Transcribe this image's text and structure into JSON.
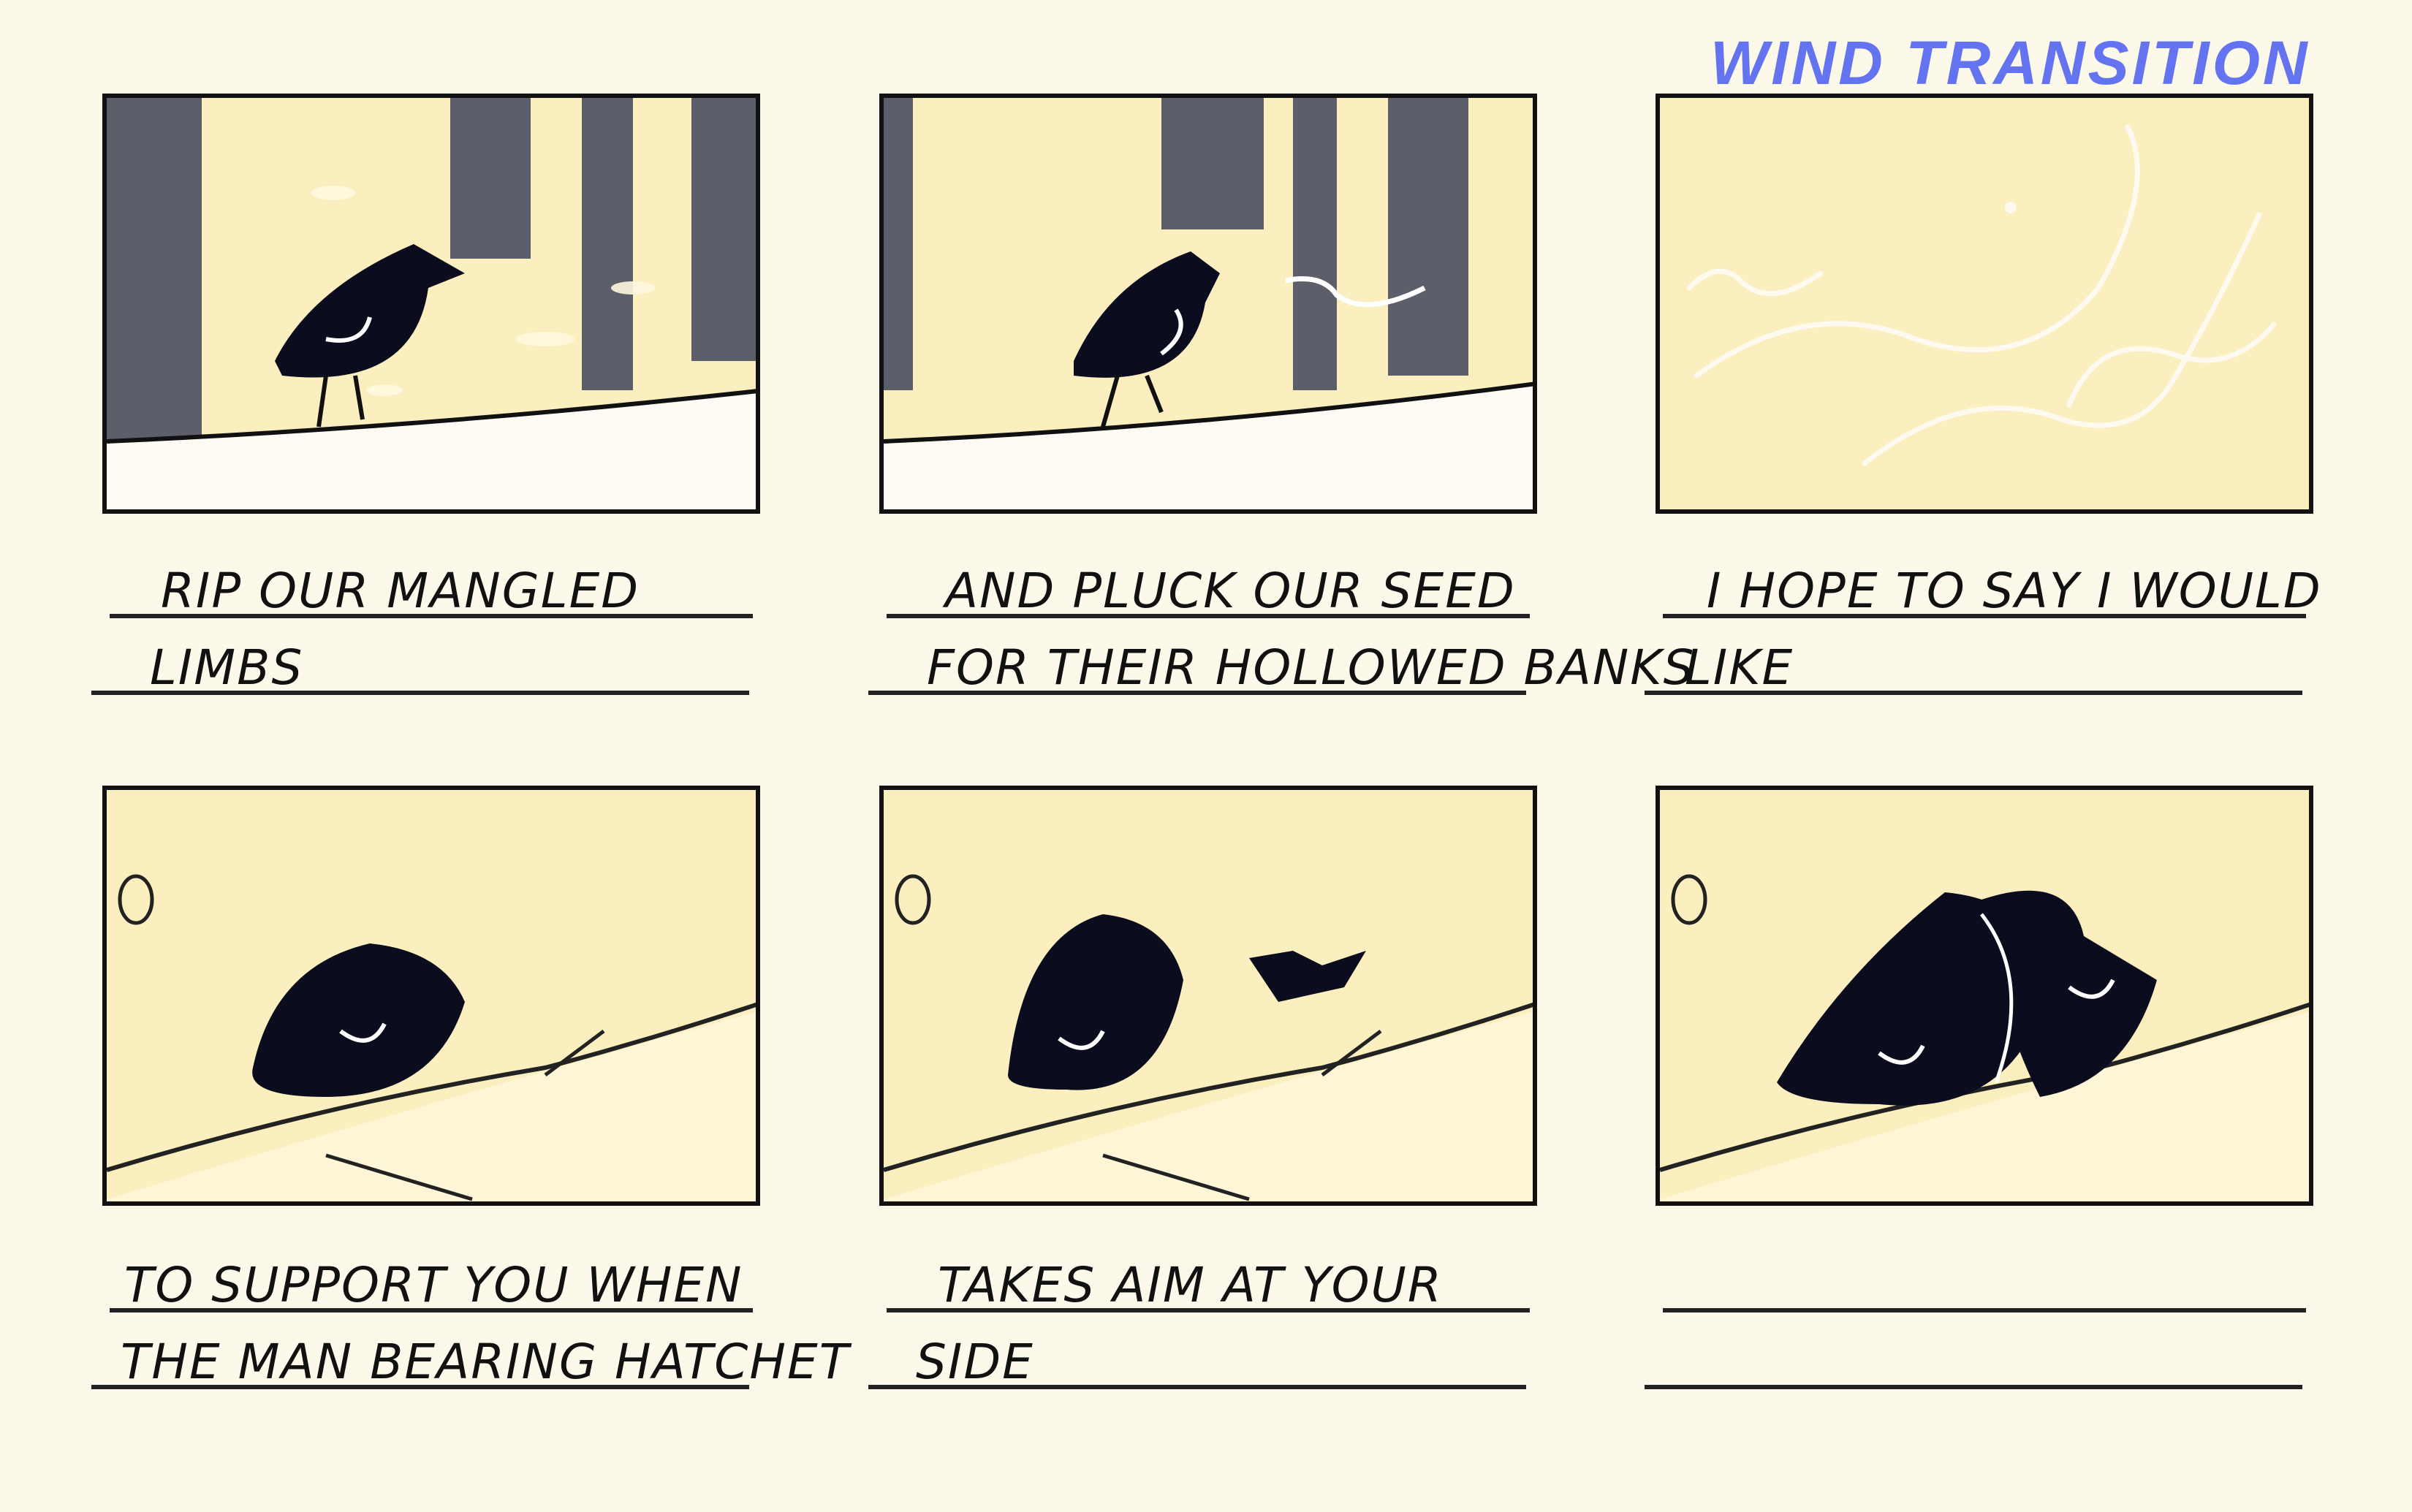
{
  "note": {
    "text": "WIND TRANSITION"
  },
  "panels": [
    {
      "caption": [
        "RIP OUR MANGLED",
        "LIMBS"
      ]
    },
    {
      "caption": [
        "AND PLUCK OUR SEED",
        "FOR THEIR HOLLOWED BANKS"
      ]
    },
    {
      "caption": [
        "I HOPE TO SAY I WOULD",
        "LIKE"
      ]
    },
    {
      "caption": [
        "TO SUPPORT YOU WHEN",
        "THE MAN BEARING HATCHET"
      ]
    },
    {
      "caption": [
        "TAKES AIM AT YOUR",
        "SIDE"
      ]
    },
    {
      "caption": [
        "",
        ""
      ]
    }
  ],
  "colors": {
    "panel_bg": "#fbeebf",
    "page_bg": "#fdf9ea",
    "trees": "#5c5e6a",
    "bird": "#0b0c1e",
    "note": "#6473f0"
  }
}
